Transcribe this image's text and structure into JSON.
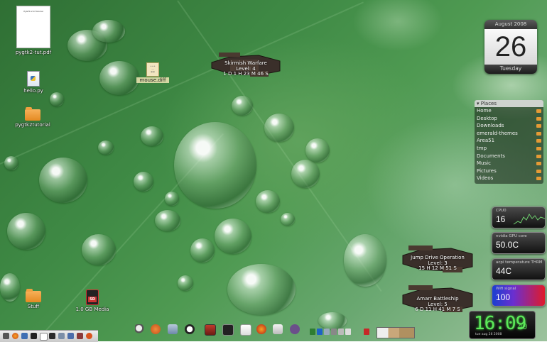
{
  "desktop": {
    "icons": [
      {
        "label": "pygtk2-tut.pdf",
        "thumb_title": "PyGTK 2.0 Tutorial"
      },
      {
        "label": "hello.py"
      },
      {
        "label": "pygtk2tutorial"
      },
      {
        "label": "mouse.diff"
      },
      {
        "label": "Stuff"
      },
      {
        "label": "1.0 GB Media"
      }
    ]
  },
  "skills": [
    {
      "name": "Skirmish Warfare",
      "level": "Level: 4",
      "time": "1 D 1 H 23 M 46 S"
    },
    {
      "name": "Jump Drive Operation",
      "level": "Level: 3",
      "time": "15 H 12 M 51 S"
    },
    {
      "name": "Amarr Battleship",
      "level": "Level: 5",
      "time": "6 D 11 H 41 M 7 S"
    }
  ],
  "calendar": {
    "month": "August 2008",
    "day": "26",
    "weekday": "Tuesday"
  },
  "places": {
    "title": "▾ Places",
    "items": [
      "Home",
      "Desktop",
      "Downloads",
      "emerald-themes",
      "Area51",
      "tmp",
      "Documents",
      "Music",
      "Pictures",
      "Videos"
    ]
  },
  "monitors": [
    {
      "label": "CPU0",
      "value": "16"
    },
    {
      "label": "nvidia GPU core",
      "value": "50.0C"
    },
    {
      "label": "acpi temperature THRM",
      "value": "44C"
    },
    {
      "label": "Wifi signal",
      "value": "100"
    }
  ],
  "clock": {
    "time": "16:09",
    "seconds": "40",
    "date": "tue  aug 26  2008"
  },
  "colors": {
    "accent": "#5de85a",
    "folder": "#e58a22",
    "leaf_green": "#3f8a45"
  },
  "dock_icons": [
    "magnifier-icon",
    "ubuntu-icon",
    "network-icon",
    "tux-icon",
    "terminal-icon",
    "monitor-icon",
    "notes-icon",
    "firefox-icon",
    "mail-icon",
    "pidgin-icon"
  ],
  "taskbar_icons": [
    "menu-icon",
    "firefox-icon",
    "mail-icon",
    "terminal-icon",
    "document-icon",
    "chart-icon",
    "files-icon",
    "music-icon",
    "settings-icon",
    "ubuntu-icon"
  ]
}
